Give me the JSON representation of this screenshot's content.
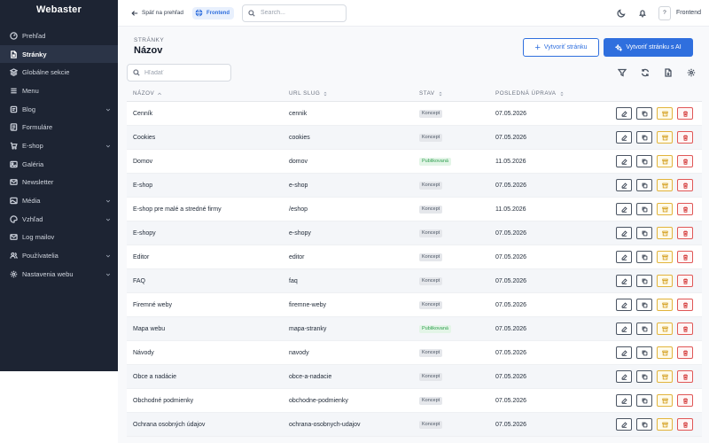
{
  "app": {
    "brand": "Webaster"
  },
  "sidebar": {
    "items": [
      {
        "label": "Prehľad",
        "icon": "gauge-icon",
        "active": false,
        "expandable": false
      },
      {
        "label": "Stránky",
        "icon": "file-icon",
        "active": true,
        "expandable": false
      },
      {
        "label": "Globálne sekcie",
        "icon": "layers-icon",
        "active": false,
        "expandable": false
      },
      {
        "label": "Menu",
        "icon": "menu-icon",
        "active": false,
        "expandable": false
      },
      {
        "label": "Blog",
        "icon": "blog-icon",
        "active": false,
        "expandable": true
      },
      {
        "label": "Formuláre",
        "icon": "form-icon",
        "active": false,
        "expandable": false
      },
      {
        "label": "E-shop",
        "icon": "cart-icon",
        "active": false,
        "expandable": true
      },
      {
        "label": "Galéria",
        "icon": "image-icon",
        "active": false,
        "expandable": false
      },
      {
        "label": "Newsletter",
        "icon": "mail-icon",
        "active": false,
        "expandable": false
      },
      {
        "label": "Média",
        "icon": "media-icon",
        "active": false,
        "expandable": true
      },
      {
        "label": "Vzhľad",
        "icon": "palette-icon",
        "active": false,
        "expandable": true
      },
      {
        "label": "Log mailov",
        "icon": "log-icon",
        "active": false,
        "expandable": false
      },
      {
        "label": "Používatelia",
        "icon": "users-icon",
        "active": false,
        "expandable": true
      },
      {
        "label": "Nastavenia webu",
        "icon": "gear-icon",
        "active": false,
        "expandable": true
      }
    ]
  },
  "topbar": {
    "back_label": "Späť na prehľad",
    "frontend_pill": "Frontend",
    "search_placeholder": "Search...",
    "help_label": "?",
    "user_label": "Frontend"
  },
  "page": {
    "subtitle": "STRÁNKY",
    "title": "Názov",
    "create_button": "Vytvoriť stránku",
    "create_ai_button": "Vytvoriť stránku s AI",
    "search_placeholder": "Hľadať"
  },
  "table": {
    "headers": {
      "name": "NÁZOV",
      "slug": "URL SLUG",
      "status": "STAV",
      "updated": "POSLEDNÁ ÚPRAVA"
    },
    "rows": [
      {
        "name": "Cenník",
        "slug": "cennik",
        "status": "Koncept",
        "published": false,
        "updated": "07.05.2026"
      },
      {
        "name": "Cookies",
        "slug": "cookies",
        "status": "Koncept",
        "published": false,
        "updated": "07.05.2026"
      },
      {
        "name": "Domov",
        "slug": "domov",
        "status": "Publikovaná",
        "published": true,
        "updated": "11.05.2026"
      },
      {
        "name": "E-shop",
        "slug": "e-shop",
        "status": "Koncept",
        "published": false,
        "updated": "07.05.2026"
      },
      {
        "name": "E-shop pre malé a stredné firmy",
        "slug": "/eshop",
        "status": "Koncept",
        "published": false,
        "updated": "11.05.2026"
      },
      {
        "name": "E-shopy",
        "slug": "e-shopy",
        "status": "Koncept",
        "published": false,
        "updated": "07.05.2026"
      },
      {
        "name": "Editor",
        "slug": "editor",
        "status": "Koncept",
        "published": false,
        "updated": "07.05.2026"
      },
      {
        "name": "FAQ",
        "slug": "faq",
        "status": "Koncept",
        "published": false,
        "updated": "07.05.2026"
      },
      {
        "name": "Firemné weby",
        "slug": "firemne-weby",
        "status": "Koncept",
        "published": false,
        "updated": "07.05.2026"
      },
      {
        "name": "Mapa webu",
        "slug": "mapa-stranky",
        "status": "Publikovaná",
        "published": true,
        "updated": "07.05.2026"
      },
      {
        "name": "Návody",
        "slug": "navody",
        "status": "Koncept",
        "published": false,
        "updated": "07.05.2026"
      },
      {
        "name": "Obce a nadácie",
        "slug": "obce-a-nadacie",
        "status": "Koncept",
        "published": false,
        "updated": "07.05.2026"
      },
      {
        "name": "Obchodné podmienky",
        "slug": "obchodne-podmienky",
        "status": "Koncept",
        "published": false,
        "updated": "07.05.2026"
      },
      {
        "name": "Ochrana osobných údajov",
        "slug": "ochrana-osobnych-udajov",
        "status": "Koncept",
        "published": false,
        "updated": "07.05.2026"
      }
    ]
  },
  "colors": {
    "sidebar_bg": "#1d2433",
    "accent": "#2f6fde",
    "published": "#2f9e4f",
    "archive": "#e2b43c",
    "delete": "#e05757"
  }
}
